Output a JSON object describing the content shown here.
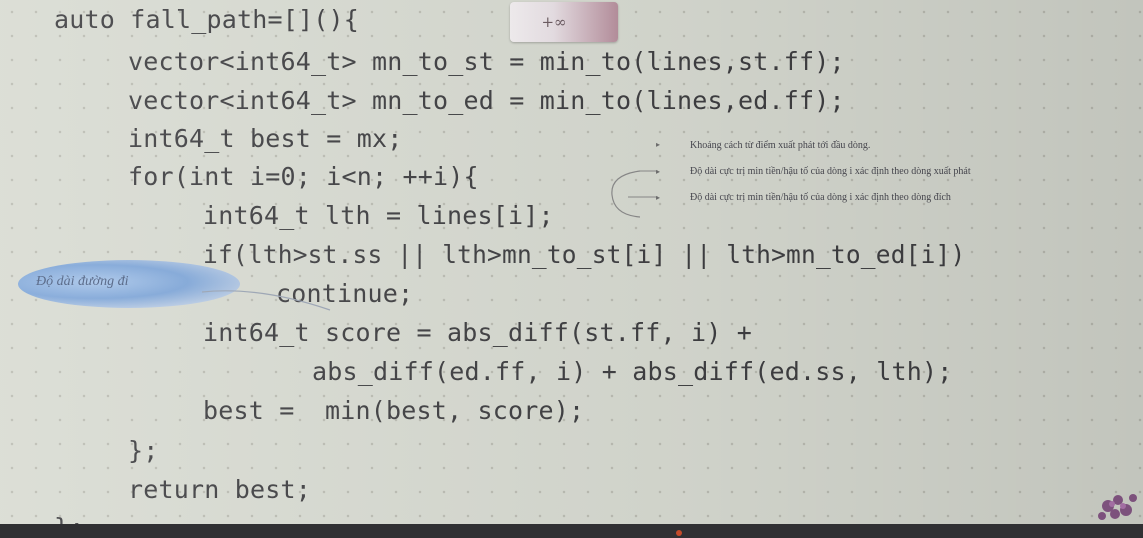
{
  "code": {
    "lines": [
      "auto fall_path=[](){",
      "vector<int64_t> mn_to_st = min_to(lines,st.ff);",
      "vector<int64_t> mn_to_ed = min_to(lines,ed.ff);",
      "int64_t best = mx;",
      "for(int i=0; i<n; ++i){",
      "int64_t lth = lines[i];",
      "if(lth>st.ss || lth>mn_to_st[i] || lth>mn_to_ed[i])",
      "continue;",
      "int64_t score = abs_diff(st.ff, i) +",
      "abs_diff(ed.ff, i) + abs_diff(ed.ss, lth);",
      "best =  min(best, score);",
      "};",
      "return best;",
      "};"
    ]
  },
  "badge": {
    "text": "+∞"
  },
  "annotations": {
    "notes": [
      "Khoảng cách từ điểm xuất phát tới đầu dòng.",
      "Độ dài cực trị min tiền/hậu tố của dòng i xác định theo dòng xuất phát",
      "Độ dài cực trị min tiền/hậu tố của dòng i xác định theo dòng đích"
    ],
    "ellipse_label": "Độ dài đường đi"
  },
  "colors": {
    "background": "#d8dbd2",
    "code_text": "#3f3f42",
    "ellipse": "#7fa6d8",
    "badge_accent": "#b8909e"
  }
}
